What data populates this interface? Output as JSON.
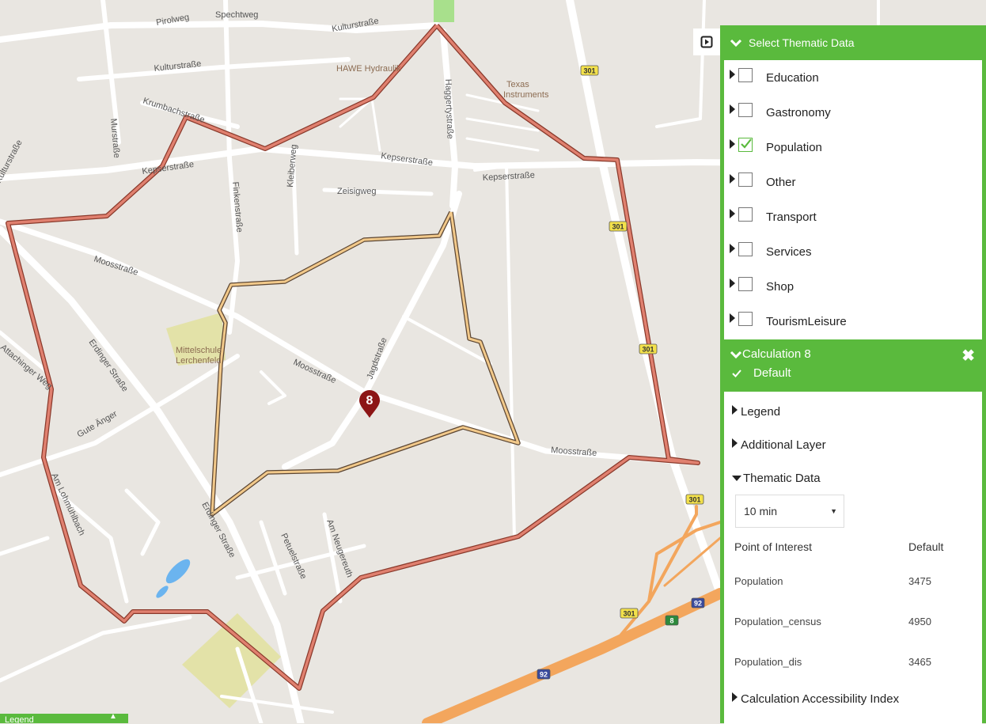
{
  "map": {
    "streets": [
      {
        "name": "Kulturstraße"
      },
      {
        "name": "Kulturstraße"
      },
      {
        "name": "Pirolweg"
      },
      {
        "name": "Spechtweg"
      },
      {
        "name": "Krumbachstraße"
      },
      {
        "name": "Murstraße"
      },
      {
        "name": "Kepserstraße"
      },
      {
        "name": "Kepserstraße"
      },
      {
        "name": "Kepserstraße"
      },
      {
        "name": "Zeisigweg"
      },
      {
        "name": "Kleiberweg"
      },
      {
        "name": "Finkenstraße"
      },
      {
        "name": "Haggertystraße"
      },
      {
        "name": "Moosstraße"
      },
      {
        "name": "Moosstraße"
      },
      {
        "name": "Moosstraße"
      },
      {
        "name": "Jagdstraße"
      },
      {
        "name": "Erdinger Straße"
      },
      {
        "name": "Erdinger Straße"
      },
      {
        "name": "Gute Änger"
      },
      {
        "name": "Attachinger Weg"
      },
      {
        "name": "Am Lohmühlbach"
      },
      {
        "name": "Petuelstraße"
      },
      {
        "name": "Am Neugereuth"
      },
      {
        "name": "Kulturstraße"
      }
    ],
    "pois": [
      {
        "name": "HAWE Hydraulik"
      },
      {
        "name": "Texas Instruments"
      },
      {
        "name": "Mittelschule Lerchenfeld"
      }
    ],
    "road_shields": [
      "301",
      "301",
      "301",
      "301",
      "301",
      "92",
      "92",
      "8"
    ],
    "marker_label": "8",
    "colors": {
      "outer_isochrone": "#e0806f",
      "inner_isochrone": "#f2c98a",
      "marker": "#8c1515",
      "highway": "#f3a65d"
    }
  },
  "toggle_button": {
    "icon": "play-square-icon"
  },
  "panel": {
    "accent_color": "#5aba3d",
    "thematic_header": "Select Thematic Data",
    "themes": [
      {
        "label": "Education",
        "checked": false
      },
      {
        "label": "Gastronomy",
        "checked": false
      },
      {
        "label": "Population",
        "checked": true
      },
      {
        "label": "Other",
        "checked": false
      },
      {
        "label": "Transport",
        "checked": false
      },
      {
        "label": "Services",
        "checked": false
      },
      {
        "label": "Shop",
        "checked": false
      },
      {
        "label": "TourismLeisure",
        "checked": false
      }
    ],
    "calculation": {
      "title": "Calculation 8",
      "subtitle": "Default",
      "legend_label": "Legend",
      "additional_layer_label": "Additional Layer",
      "thematic_data_label": "Thematic Data",
      "time_select": {
        "value": "10 min"
      },
      "table": {
        "headers": [
          "Point of Interest",
          "Default"
        ],
        "rows": [
          [
            "Population",
            "3475"
          ],
          [
            "Population_census",
            "4950"
          ],
          [
            "Population_dis",
            "3465"
          ]
        ]
      },
      "accessibility_label": "Calculation Accessibility Index"
    }
  },
  "legend_tab": {
    "label": "Legend"
  }
}
